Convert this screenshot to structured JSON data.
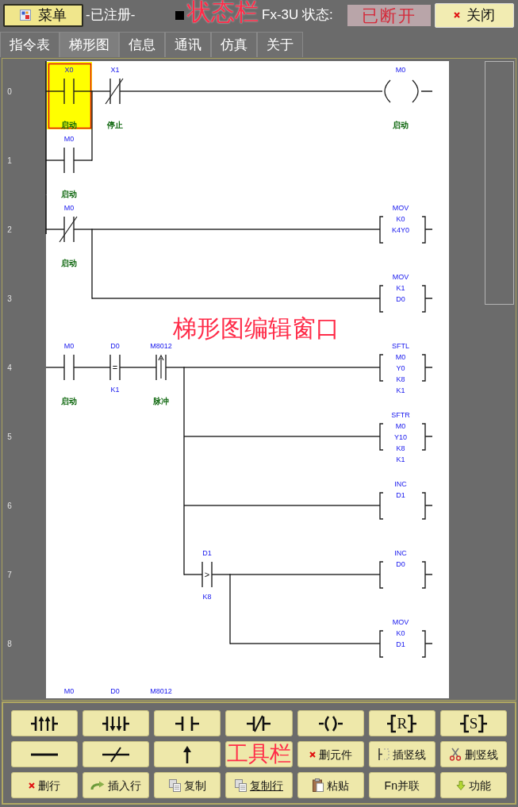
{
  "status_bar": {
    "menu_button": "菜单",
    "registration": "-已注册-",
    "plc_status_label": "Fx-3U 状态:",
    "connection_status": "已断开",
    "close_button": "关闭",
    "annotation": "状态栏"
  },
  "tabs": [
    {
      "label": "指令表",
      "selected": false
    },
    {
      "label": "梯形图",
      "selected": true
    },
    {
      "label": "信息",
      "selected": false
    },
    {
      "label": "通讯",
      "selected": false
    },
    {
      "label": "仿真",
      "selected": false
    },
    {
      "label": "关于",
      "selected": false
    }
  ],
  "ladder": {
    "annotation": "梯形图编辑窗口",
    "rungs": [
      {
        "rail": true,
        "number": "0",
        "cells": [
          {
            "kind": "no_contact",
            "device": "X0",
            "comment": "启动",
            "selected": true,
            "parallel": [
              {
                "number": "1",
                "cells": [
                  {
                    "kind": "no_contact",
                    "device": "M0",
                    "comment": "启动",
                    "selected": false
                  }
                ]
              }
            ]
          },
          {
            "kind": "nc_contact",
            "device": "X1",
            "comment": "停止",
            "selected": false
          }
        ],
        "output": {
          "kind": "coil",
          "device": "M0",
          "comment": "启动"
        }
      },
      {
        "rail": true,
        "number": "2",
        "cells": [
          {
            "kind": "nc_contact",
            "device": "M0",
            "comment": "启动",
            "selected": false,
            "branches": [
              {
                "number": "3",
                "output": {
                  "kind": "instruction",
                  "name": "MOV",
                  "operands": [
                    "K1",
                    "D0"
                  ]
                }
              }
            ]
          }
        ],
        "output": {
          "kind": "instruction",
          "name": "MOV",
          "operands": [
            "K0",
            "K4Y0"
          ]
        }
      },
      {
        "rail": false,
        "number": "4",
        "cells": [
          {
            "kind": "no_contact",
            "device": "M0",
            "comment": "启动",
            "selected": false
          },
          {
            "kind": "compare_contact",
            "device": "D0",
            "operator": "=",
            "operand": "K1",
            "selected": false
          },
          {
            "kind": "rising_contact",
            "device": "M8012",
            "comment": "脉冲",
            "selected": false,
            "branches": [
              {
                "number": "5",
                "output": {
                  "kind": "instruction",
                  "name": "SFTR",
                  "operands": [
                    "M0",
                    "Y10",
                    "K8",
                    "K1"
                  ]
                }
              },
              {
                "number": "6",
                "output": {
                  "kind": "instruction",
                  "name": "INC",
                  "operands": [
                    "D1"
                  ]
                }
              },
              {
                "number": "7",
                "cells": [
                  {
                    "kind": "compare_contact",
                    "device": "D1",
                    "operator": ">",
                    "operand": "K8",
                    "selected": false,
                    "branches": [
                      {
                        "number": "8",
                        "output": {
                          "kind": "instruction",
                          "name": "MOV",
                          "operands": [
                            "K0",
                            "D1"
                          ]
                        }
                      }
                    ]
                  }
                ],
                "output": {
                  "kind": "instruction",
                  "name": "INC",
                  "operands": [
                    "D0"
                  ]
                }
              }
            ]
          }
        ],
        "output": {
          "kind": "instruction",
          "name": "SFTL",
          "operands": [
            "M0",
            "Y0",
            "K8",
            "K1"
          ]
        }
      }
    ],
    "next_row_devices": [
      "M0",
      "D0",
      "M8012"
    ]
  },
  "toolbar": {
    "annotation": "工具栏",
    "buttons": [
      {
        "kind": "rising_contact"
      },
      {
        "kind": "falling_contact"
      },
      {
        "kind": "contact"
      },
      {
        "kind": "nc_contact"
      },
      {
        "kind": "coil"
      },
      {
        "kind": "bracket",
        "label": "R"
      },
      {
        "kind": "bracket",
        "label": "S"
      },
      {
        "kind": "line"
      },
      {
        "kind": "not_line"
      },
      {
        "kind": "arrow"
      },
      {
        "kind": "blank"
      },
      {
        "kind": "delete",
        "label": "删元件",
        "underlined": false
      },
      {
        "kind": "insert_vline",
        "label": "插竖线",
        "underlined": false
      },
      {
        "kind": "cut",
        "label": "删竖线",
        "underlined": false
      },
      {
        "kind": "delete",
        "label": "删行",
        "underlined": false
      },
      {
        "kind": "insert",
        "label": "插入行",
        "underlined": false
      },
      {
        "kind": "copy",
        "label": "复制",
        "underlined": false
      },
      {
        "kind": "copy",
        "label": "复制行",
        "underlined": true
      },
      {
        "kind": "paste",
        "label": "粘贴",
        "underlined": false
      },
      {
        "kind": "text",
        "label": "Fn并联",
        "underlined": false
      },
      {
        "kind": "function",
        "label": "功能",
        "underlined": false
      }
    ]
  }
}
